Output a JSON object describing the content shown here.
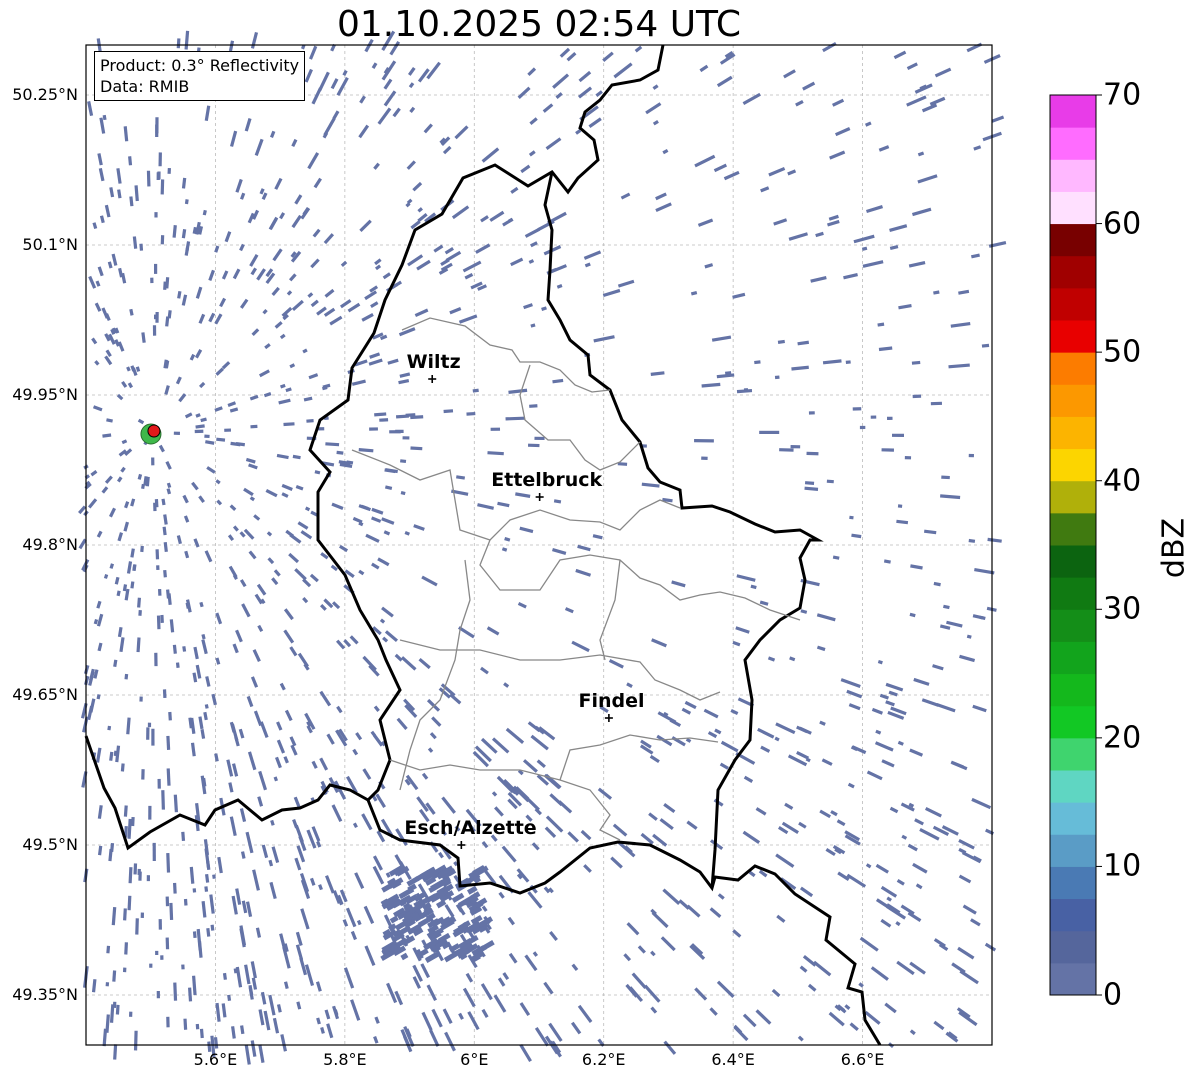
{
  "title": "01.10.2025 02:54 UTC",
  "info": {
    "product": "Product: 0.3° Reflectivity",
    "data": "Data: RMIB"
  },
  "map": {
    "lon_range": [
      5.4,
      6.8
    ],
    "lat_range": [
      49.3,
      50.3
    ],
    "lat_ticks": [
      {
        "value": 50.25,
        "label": "50.25°N"
      },
      {
        "value": 50.1,
        "label": "50.1°N"
      },
      {
        "value": 49.95,
        "label": "49.95°N"
      },
      {
        "value": 49.8,
        "label": "49.8°N"
      },
      {
        "value": 49.65,
        "label": "49.65°N"
      },
      {
        "value": 49.5,
        "label": "49.5°N"
      },
      {
        "value": 49.35,
        "label": "49.35°N"
      }
    ],
    "lon_ticks": [
      {
        "value": 5.6,
        "label": "5.6°E"
      },
      {
        "value": 5.8,
        "label": "5.8°E"
      },
      {
        "value": 6.0,
        "label": "6°E"
      },
      {
        "value": 6.2,
        "label": "6.2°E"
      },
      {
        "value": 6.4,
        "label": "6.4°E"
      },
      {
        "value": 6.6,
        "label": "6.6°E"
      }
    ],
    "gridlines": true,
    "echo_color": "#6473a6",
    "radar_site": {
      "lon": 5.505,
      "lat": 49.914,
      "marker_color": "#e21a1a"
    },
    "cities": [
      {
        "name": "Wiltz",
        "lon": 5.935,
        "lat": 49.966
      },
      {
        "name": "Ettelbruck",
        "lon": 6.101,
        "lat": 49.848
      },
      {
        "name": "Findel",
        "lon": 6.208,
        "lat": 49.627
      },
      {
        "name": "Esch/Alzette",
        "lon": 5.98,
        "lat": 49.5
      }
    ]
  },
  "colorbar": {
    "label": "dBZ",
    "min": 0,
    "max": 70,
    "step": 2.5,
    "ticks": [
      0,
      10,
      20,
      30,
      40,
      50,
      60,
      70
    ],
    "colors": [
      "#6473a6",
      "#55669c",
      "#4861a4",
      "#4a7ab4",
      "#5a9cc6",
      "#66bcd8",
      "#5fd6c2",
      "#3fd46e",
      "#12c824",
      "#14b81c",
      "#12a41c",
      "#148e18",
      "#107a12",
      "#0c6410",
      "#407a10",
      "#b0b00a",
      "#fcd500",
      "#fcb400",
      "#fc9800",
      "#fc7c00",
      "#e80000",
      "#c00000",
      "#a00000",
      "#780000",
      "#ffe0ff",
      "#ffb8ff",
      "#ff6cff",
      "#e83ce8"
    ]
  }
}
